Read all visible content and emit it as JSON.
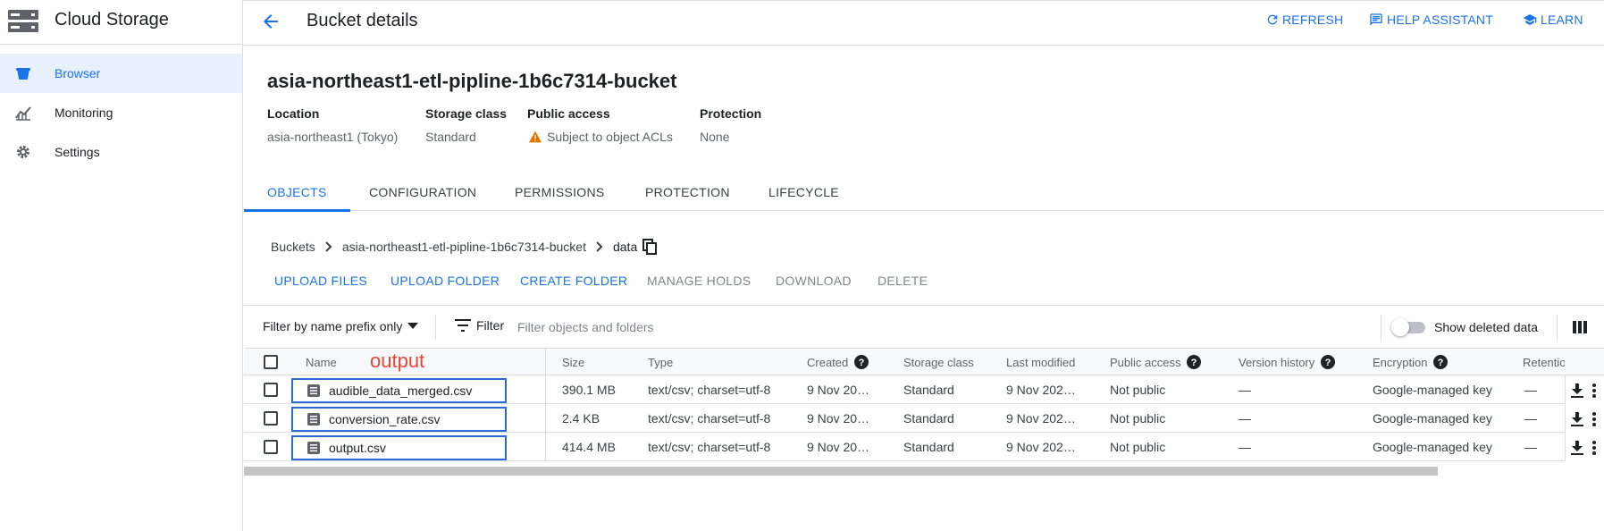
{
  "app": {
    "title": "Cloud Storage",
    "logo_icon": "storage-logo-icon"
  },
  "sidebar": {
    "items": [
      {
        "label": "Browser",
        "icon": "bucket-icon",
        "active": true
      },
      {
        "label": "Monitoring",
        "icon": "chart-icon",
        "active": false
      },
      {
        "label": "Settings",
        "icon": "gear-icon",
        "active": false
      }
    ]
  },
  "header": {
    "title": "Bucket details",
    "actions": {
      "refresh": "REFRESH",
      "help": "HELP ASSISTANT",
      "learn": "LEARN"
    }
  },
  "bucket": {
    "name": "asia-northeast1-etl-pipline-1b6c7314-bucket",
    "info": [
      {
        "label": "Location",
        "value": "asia-northeast1 (Tokyo)"
      },
      {
        "label": "Storage class",
        "value": "Standard"
      },
      {
        "label": "Public access",
        "value": "Subject to object ACLs",
        "icon": "warning-icon"
      },
      {
        "label": "Protection",
        "value": "None"
      }
    ]
  },
  "tabs": [
    "OBJECTS",
    "CONFIGURATION",
    "PERMISSIONS",
    "PROTECTION",
    "LIFECYCLE"
  ],
  "active_tab": "OBJECTS",
  "breadcrumb": [
    "Buckets",
    "asia-northeast1-etl-pipline-1b6c7314-bucket",
    "data"
  ],
  "actions": [
    {
      "label": "UPLOAD FILES",
      "enabled": true
    },
    {
      "label": "UPLOAD FOLDER",
      "enabled": true
    },
    {
      "label": "CREATE FOLDER",
      "enabled": true
    },
    {
      "label": "MANAGE HOLDS",
      "enabled": false
    },
    {
      "label": "DOWNLOAD",
      "enabled": false
    },
    {
      "label": "DELETE",
      "enabled": false
    }
  ],
  "filter": {
    "mode": "Filter by name prefix only",
    "button": "Filter",
    "placeholder": "Filter objects and folders",
    "show_deleted": "Show deleted data",
    "show_deleted_on": false
  },
  "table": {
    "columns": [
      "Name",
      "Size",
      "Type",
      "Created",
      "Storage class",
      "Last modified",
      "Public access",
      "Version history",
      "Encryption",
      "Retentio"
    ],
    "rows": [
      {
        "name": "audible_data_merged.csv",
        "size": "390.1 MB",
        "type": "text/csv; charset=utf-8",
        "created": "9 Nov 20…",
        "storage_class": "Standard",
        "last_modified": "9 Nov 202…",
        "public_access": "Not public",
        "version_history": "—",
        "encryption": "Google-managed key",
        "retention": "—"
      },
      {
        "name": "conversion_rate.csv",
        "size": "2.4 KB",
        "type": "text/csv; charset=utf-8",
        "created": "9 Nov 20…",
        "storage_class": "Standard",
        "last_modified": "9 Nov 202…",
        "public_access": "Not public",
        "version_history": "—",
        "encryption": "Google-managed key",
        "retention": "—"
      },
      {
        "name": "output.csv",
        "size": "414.4 MB",
        "type": "text/csv; charset=utf-8",
        "created": "9 Nov 20…",
        "storage_class": "Standard",
        "last_modified": "9 Nov 202…",
        "public_access": "Not public",
        "version_history": "—",
        "encryption": "Google-managed key",
        "retention": "—"
      }
    ]
  },
  "annotation": "output",
  "colors": {
    "accent": "#1a73e8",
    "annotation": "#ea4335",
    "warning": "#e37400",
    "highlight_box": "#2b6bd6"
  }
}
